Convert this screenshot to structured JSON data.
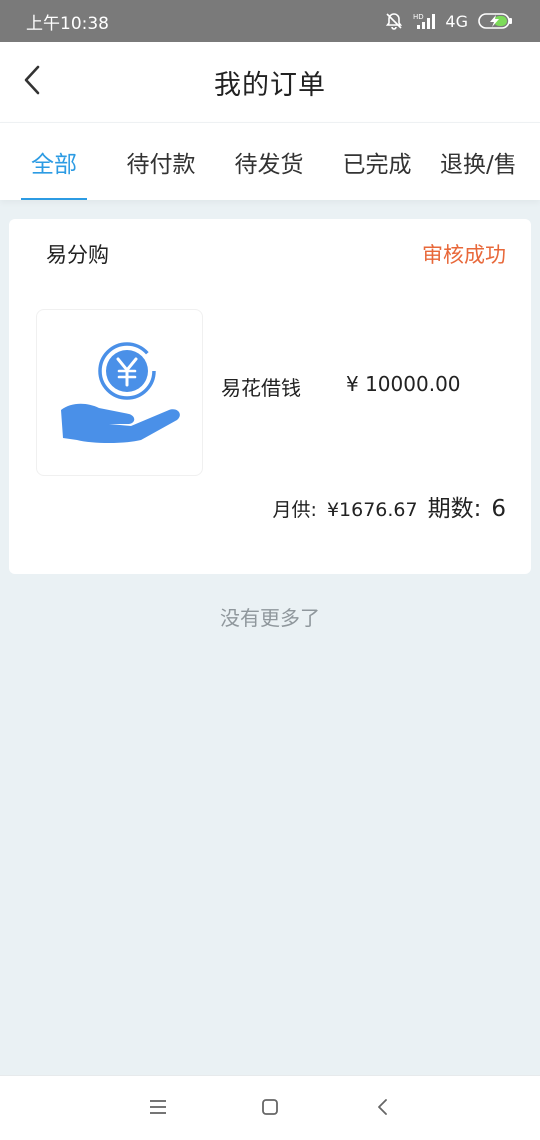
{
  "status_bar": {
    "time": "上午10:38",
    "network": "4G",
    "icons": [
      "bell-off-icon",
      "hd-signal-icon",
      "battery-charging-icon"
    ]
  },
  "header": {
    "title": "我的订单",
    "back_icon": "chevron-left-icon"
  },
  "tabs": [
    {
      "label": "全部",
      "active": true
    },
    {
      "label": "待付款",
      "active": false
    },
    {
      "label": "待发货",
      "active": false
    },
    {
      "label": "已完成",
      "active": false
    },
    {
      "label": "退换/售",
      "active": false
    }
  ],
  "order": {
    "shop_name": "易分购",
    "status": "审核成功",
    "product_name": "易花借钱",
    "price": "¥ 10000.00",
    "monthly_label": "月供:",
    "monthly_value": "¥1676.67",
    "period_label": "期数:",
    "period_value": "6",
    "thumbnail_icon": "hand-yuan-coin-icon"
  },
  "footer_text": "没有更多了",
  "system_nav": {
    "menu_icon": "menu-icon",
    "home_icon": "home-square-icon",
    "back_icon": "back-chevron-icon"
  },
  "colors": {
    "accent": "#2c9be3",
    "status_orange": "#e8683a",
    "background": "#eaf1f4"
  }
}
